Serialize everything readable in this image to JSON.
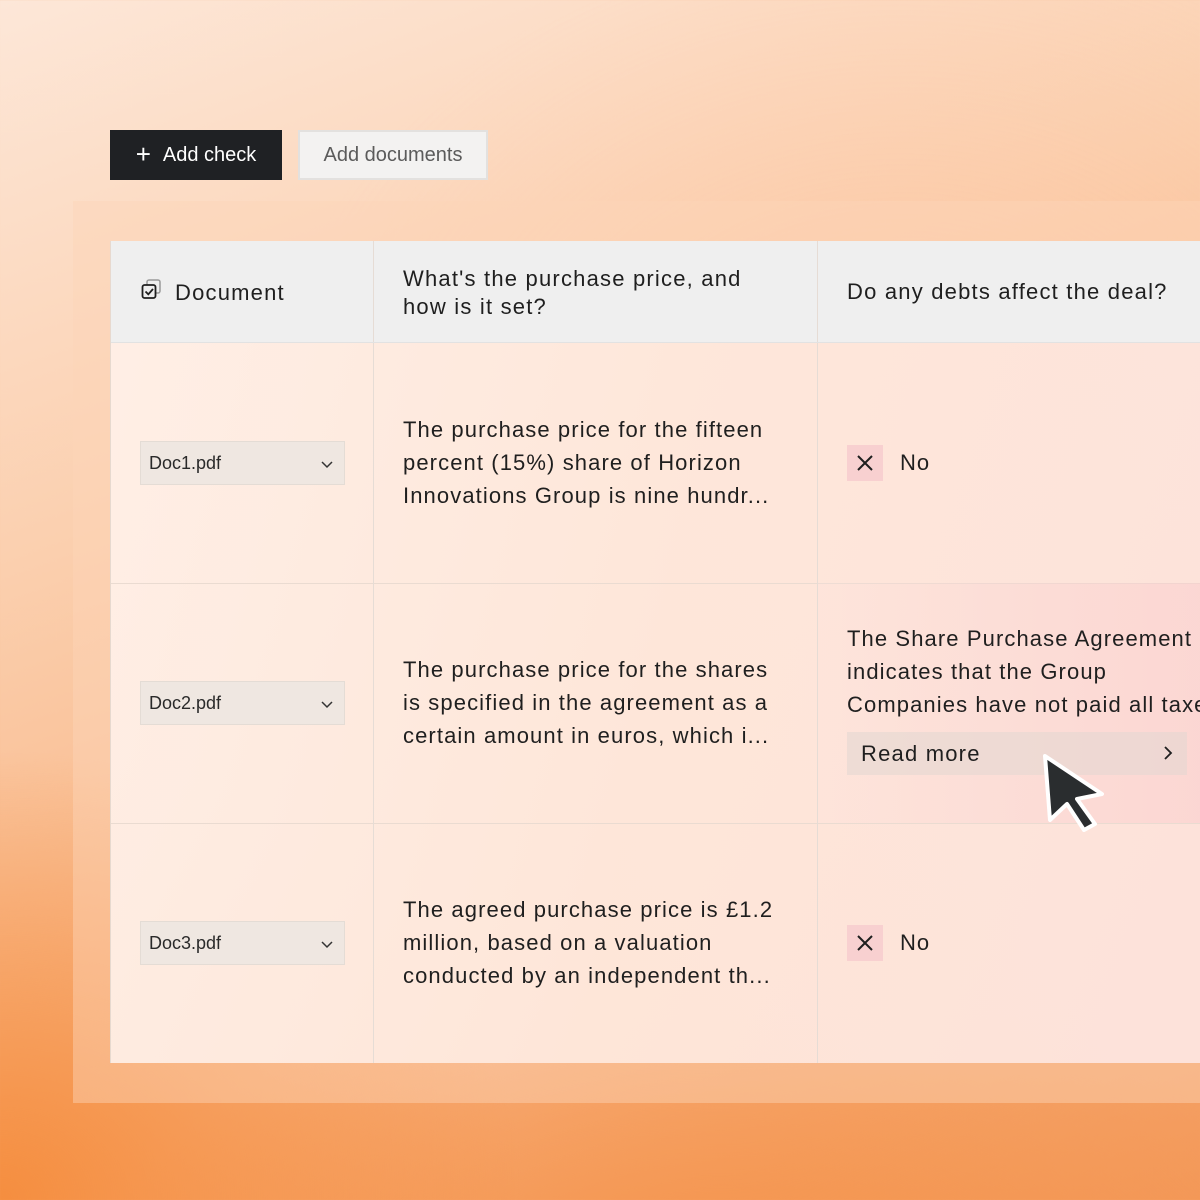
{
  "toolbar": {
    "add_check_label": "Add check",
    "add_documents_label": "Add documents"
  },
  "table": {
    "headers": {
      "document": "Document",
      "question_1": [
        "What's the purchase price, and",
        "how is it set?"
      ],
      "question_2": "Do any debts affect the deal?"
    },
    "rows": [
      {
        "document": "Doc1.pdf",
        "answer_1": [
          "The purchase price for the fifteen",
          "percent (15%) share of Horizon",
          "Innovations Group is nine hundr..."
        ],
        "answer_2": "No"
      },
      {
        "document": "Doc2.pdf",
        "answer_1": [
          "The purchase price for the shares",
          "is specified in the agreement as a",
          "certain amount in euros, which i..."
        ],
        "answer_2_text": [
          "The Share Purchase Agreement",
          "indicates that the Group",
          "Companies have not paid all taxes"
        ],
        "read_more_label": "Read more"
      },
      {
        "document": "Doc3.pdf",
        "answer_1": [
          "The agreed purchase price is £1.2",
          "million, based on a valuation",
          "conducted by an independent th..."
        ],
        "answer_2": "No"
      }
    ]
  },
  "colors": {
    "dark_button": "#1f2124",
    "negative_badge": "#f8d0d0",
    "header_bg": "#efefef"
  },
  "icons": {
    "add": "plus-icon",
    "header_document": "checkbox-stack-icon",
    "select": "chevron-down-icon",
    "negative": "close-icon",
    "read_more": "chevron-right-icon",
    "pointer": "mouse-cursor-icon"
  }
}
